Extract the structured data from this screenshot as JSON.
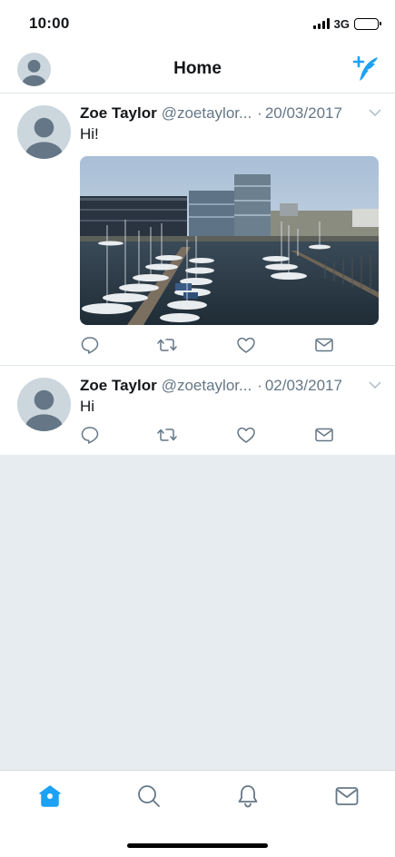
{
  "status_bar": {
    "time": "10:00",
    "network": "3G",
    "icons": [
      "signal-icon",
      "battery-icon"
    ]
  },
  "header": {
    "title": "Home",
    "left_icon": "avatar",
    "right_icon": "compose-tweet-icon"
  },
  "tweets": [
    {
      "name": "Zoe Taylor",
      "handle": "@zoetaylor...",
      "date": "20/03/2017",
      "text": "Hi!",
      "has_media": true,
      "media_icon": "harbour-photo"
    },
    {
      "name": "Zoe Taylor",
      "handle": "@zoetaylor...",
      "date": "02/03/2017",
      "text": "Hi",
      "has_media": false
    }
  ],
  "tweet_actions": [
    "reply-icon",
    "retweet-icon",
    "like-icon",
    "direct-message-icon"
  ],
  "tab_bar": {
    "tabs": [
      {
        "icon": "home-icon",
        "active": true
      },
      {
        "icon": "search-icon",
        "active": false
      },
      {
        "icon": "notifications-icon",
        "active": false
      },
      {
        "icon": "messages-icon",
        "active": false
      }
    ]
  },
  "colors": {
    "accent": "#1da1f2",
    "icon_gray": "#657786",
    "text": "#14171a",
    "secondary_text": "#657786",
    "divider": "#e1e8ed",
    "timeline_background": "#e6ecf0",
    "avatar_bg": "#ccd6dd",
    "avatar_fg": "#657786"
  }
}
